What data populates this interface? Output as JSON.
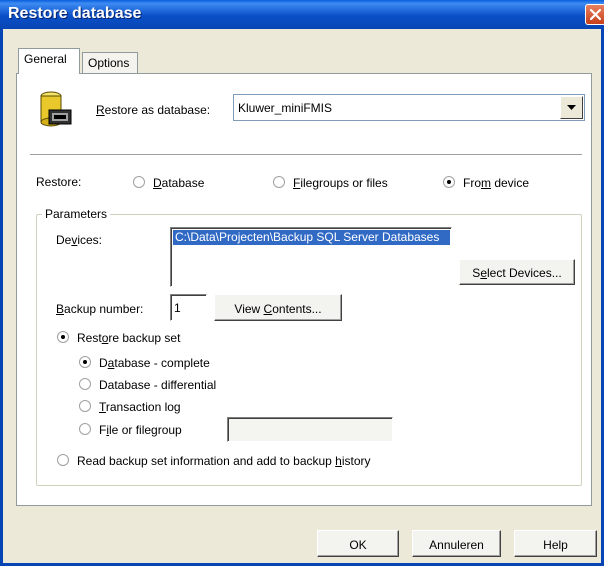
{
  "window": {
    "title": "Restore database"
  },
  "tabs": [
    {
      "label": "General"
    },
    {
      "label": "Options"
    }
  ],
  "general": {
    "restore_as": {
      "label_pre": "",
      "label_mnemonic": "R",
      "label_post": "estore as database:",
      "value": "Kluwer_miniFMIS"
    },
    "restore": {
      "label": "Restore:",
      "options": [
        {
          "pre": "",
          "mn": "D",
          "post": "atabase"
        },
        {
          "pre": "",
          "mn": "F",
          "post": "ilegroups or files"
        },
        {
          "pre": "Fro",
          "mn": "m",
          "post": " device"
        }
      ],
      "selected": 2
    }
  },
  "parameters": {
    "title": "Parameters",
    "devices_label": {
      "pre": "De",
      "mn": "v",
      "post": "ices:"
    },
    "devices": [
      "C:\\Data\\Projecten\\Backup SQL Server Databases"
    ],
    "select_devices": {
      "pre": "S",
      "mn": "e",
      "post": "lect Devices..."
    },
    "backup_number_label": {
      "pre": "",
      "mn": "B",
      "post": "ackup number:"
    },
    "backup_number": "1",
    "view_contents": {
      "pre": "View ",
      "mn": "C",
      "post": "ontents..."
    },
    "restore_backup_set": {
      "pre": "Rest",
      "mn": "o",
      "post": "re backup set"
    },
    "backup_set_options": [
      {
        "pre": "D",
        "mn": "a",
        "post": "tabase - complete"
      },
      {
        "pre": "Database",
        "mn": "",
        "post": " - differential"
      },
      {
        "pre": "",
        "mn": "T",
        "post": "ransaction log"
      },
      {
        "pre": "F",
        "mn": "i",
        "post": "le or filegroup"
      }
    ],
    "backup_set_selected": 0,
    "file_or_filegroup_value": "",
    "read_backup_info": {
      "pre": "Read backup set information and add to backup ",
      "mn": "h",
      "post": "istory"
    }
  },
  "footer": {
    "ok": "OK",
    "cancel": "Annuleren",
    "help": "Help"
  },
  "colors": {
    "titlebar": "#0a4fc8",
    "selection": "#316ac5",
    "close_button": "#d6542b",
    "dialog_bg": "#ece9d8"
  },
  "icons": {
    "database": "database-icon",
    "close": "close-icon",
    "dropdown": "chevron-down-icon"
  }
}
